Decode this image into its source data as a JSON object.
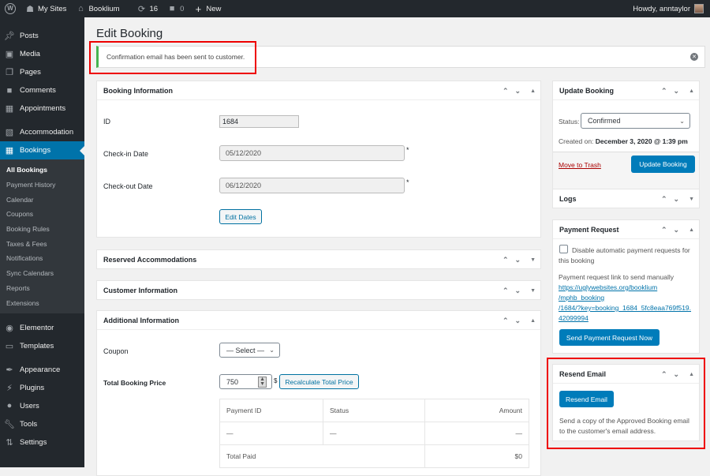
{
  "adminbar": {
    "wp_logo": "wordpress-icon",
    "my_sites": "My Sites",
    "site_name": "Booklium",
    "updates_count": "16",
    "comments_count": "0",
    "new_label": "New",
    "howdy": "Howdy, anntaylor"
  },
  "sidebar": {
    "items": [
      {
        "label": "Posts",
        "icon": "pin-icon"
      },
      {
        "label": "Media",
        "icon": "media-icon"
      },
      {
        "label": "Pages",
        "icon": "pages-icon"
      },
      {
        "label": "Comments",
        "icon": "comment-icon"
      },
      {
        "label": "Appointments",
        "icon": "calendar-icon"
      },
      {
        "label": "Accommodation",
        "icon": "building-icon"
      },
      {
        "label": "Bookings",
        "icon": "calendar-icon"
      },
      {
        "label": "Elementor",
        "icon": "elementor-icon"
      },
      {
        "label": "Templates",
        "icon": "folder-icon"
      },
      {
        "label": "Appearance",
        "icon": "paintbrush-icon"
      },
      {
        "label": "Plugins",
        "icon": "plug-icon"
      },
      {
        "label": "Users",
        "icon": "user-icon"
      },
      {
        "label": "Tools",
        "icon": "wrench-icon"
      },
      {
        "label": "Settings",
        "icon": "settings-icon"
      }
    ],
    "submenu": [
      "All Bookings",
      "Payment History",
      "Calendar",
      "Coupons",
      "Booking Rules",
      "Taxes & Fees",
      "Notifications",
      "Sync Calendars",
      "Reports",
      "Extensions"
    ]
  },
  "page": {
    "title": "Edit Booking",
    "notice": "Confirmation email has been sent to customer."
  },
  "booking_info": {
    "title": "Booking Information",
    "id_label": "ID",
    "id_value": "1684",
    "checkin_label": "Check-in Date",
    "checkin_value": "05/12/2020",
    "checkout_label": "Check-out Date",
    "checkout_value": "06/12/2020",
    "required_mark": "*",
    "edit_dates": "Edit Dates"
  },
  "reserved": {
    "title": "Reserved Accommodations"
  },
  "customer": {
    "title": "Customer Information"
  },
  "additional": {
    "title": "Additional Information",
    "coupon_label": "Coupon",
    "coupon_value": "— Select —",
    "price_label": "Total Booking Price",
    "price_value": "750",
    "currency": "$",
    "recalc": "Recalculate Total Price",
    "table": {
      "headers": [
        "Payment ID",
        "Status",
        "Amount"
      ],
      "rows": [
        [
          "—",
          "—",
          "—"
        ]
      ],
      "total_label": "Total Paid",
      "total_value": "$0"
    }
  },
  "update_booking": {
    "title": "Update Booking",
    "status_label": "Status:",
    "status_value": "Confirmed",
    "created_label": "Created on:",
    "created_value": "December 3, 2020 @ 1:39 pm",
    "trash": "Move to Trash",
    "update": "Update Booking"
  },
  "logs": {
    "title": "Logs"
  },
  "payment_request": {
    "title": "Payment Request",
    "checkbox_label": "Disable automatic payment requests for this booking",
    "checked": false,
    "link_label": "Payment request link to send manually",
    "link_lines": [
      "https://uglywebsites.org/booklium",
      "/mphb_booking",
      "/1684/?key=booking_1684_5fc8eaa769f519.",
      "42099994"
    ],
    "send_button": "Send Payment Request Now"
  },
  "resend_email": {
    "title": "Resend Email",
    "button": "Resend Email",
    "description": "Send a copy of the Approved Booking email to the customer's email address."
  },
  "colors": {
    "accent": "#0073aa",
    "success": "#46b450",
    "highlight": "#ee0000",
    "trash": "#a00"
  }
}
